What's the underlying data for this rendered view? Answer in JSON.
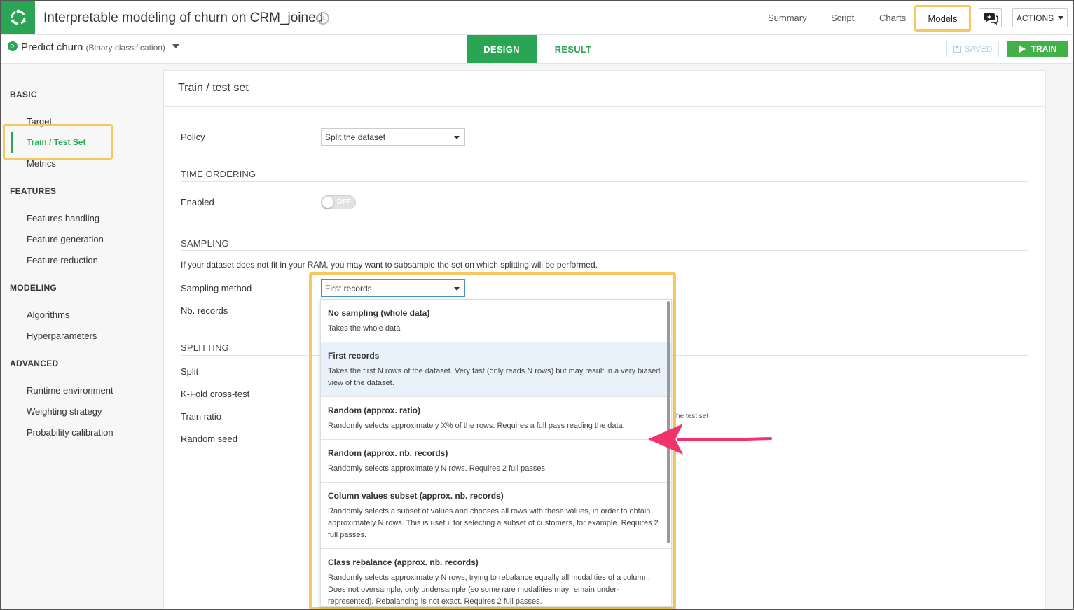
{
  "header": {
    "project_title": "Interpretable modeling of churn on CRM_joined",
    "nav": [
      "Summary",
      "Script",
      "Charts",
      "Models"
    ],
    "actions_label": "ACTIONS"
  },
  "analysis": {
    "name": "Predict churn",
    "type": "(Binary classification)",
    "tab_design": "DESIGN",
    "tab_result": "RESULT",
    "saved_label": "SAVED",
    "train_label": "TRAIN"
  },
  "sidebar": {
    "sections": [
      {
        "title": "BASIC",
        "items": [
          "Target",
          "Train / Test Set",
          "Metrics"
        ]
      },
      {
        "title": "FEATURES",
        "items": [
          "Features handling",
          "Feature generation",
          "Feature reduction"
        ]
      },
      {
        "title": "MODELING",
        "items": [
          "Algorithms",
          "Hyperparameters"
        ]
      },
      {
        "title": "ADVANCED",
        "items": [
          "Runtime environment",
          "Weighting strategy",
          "Probability calibration"
        ]
      }
    ],
    "active_item": "Train / Test Set"
  },
  "panel": {
    "title": "Train / test set",
    "policy_label": "Policy",
    "policy_value": "Split the dataset",
    "time_ordering_title": "TIME ORDERING",
    "enabled_label": "Enabled",
    "toggle_text": "OFF",
    "sampling_title": "SAMPLING",
    "sampling_hint": "If your dataset does not fit in your RAM, you may want to subsample the set on which splitting will be performed.",
    "sampling_method_label": "Sampling method",
    "sampling_method_value": "First records",
    "nb_records_label": "Nb. records",
    "splitting_title": "SPLITTING",
    "split_label": "Split",
    "kfold_label": "K-Fold cross-test",
    "train_ratio_label": "Train ratio",
    "random_seed_label": "Random seed",
    "test_set_fragment": "he test set"
  },
  "dropdown": {
    "options": [
      {
        "title": "No sampling (whole data)",
        "desc": "Takes the whole data"
      },
      {
        "title": "First records",
        "desc": "Takes the first N rows of the dataset. Very fast (only reads N rows) but may result in a very biased view of the dataset."
      },
      {
        "title": "Random (approx. ratio)",
        "desc": "Randomly selects approximately X% of the rows. Requires a full pass reading the data."
      },
      {
        "title": "Random (approx. nb. records)",
        "desc": "Randomly selects approximately N rows. Requires 2 full passes."
      },
      {
        "title": "Column values subset (approx. nb. records)",
        "desc": "Randomly selects a subset of values and chooses all rows with these values, in order to obtain approximately N rows. This is useful for selecting a subset of customers, for example. Requires 2 full passes."
      },
      {
        "title": "Class rebalance (approx. nb. records)",
        "desc": "Randomly selects approximately N rows, trying to rebalance equally all modalities of a column. Does not oversample, only undersample (so some rare modalities may remain under-represented). Rebalancing is not exact. Requires 2 full passes."
      }
    ],
    "selected_index": 1
  },
  "colors": {
    "brand_green": "#2aa553",
    "highlight_yellow": "#f7c85f",
    "arrow_pink": "#f0336b"
  }
}
